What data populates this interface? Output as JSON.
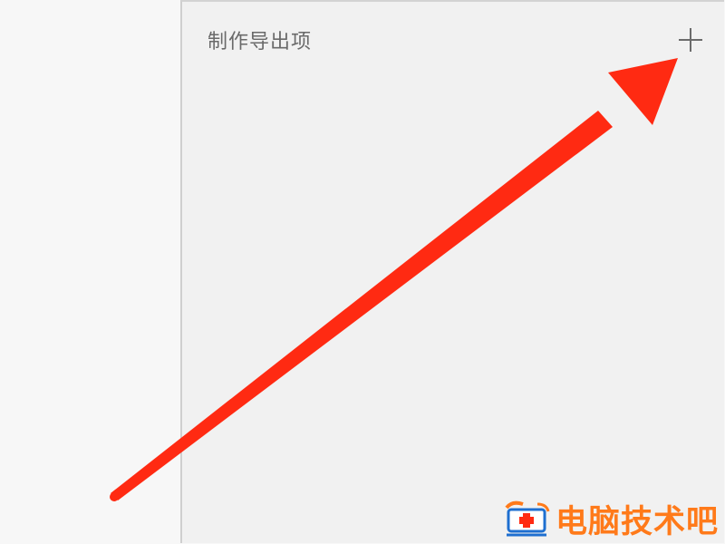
{
  "panel": {
    "title": "制作导出项",
    "add_button_icon": "plus-icon"
  },
  "annotation": {
    "type": "arrow",
    "color": "#ff2a12"
  },
  "watermark": {
    "text": "电脑技术吧",
    "logo_icon": "computer-medical-cross-logo",
    "color": "#ff7a1a"
  },
  "colors": {
    "panel_bg": "#f1f1f1",
    "page_bg": "#f7f7f7",
    "title_text": "#6a6a6a"
  }
}
